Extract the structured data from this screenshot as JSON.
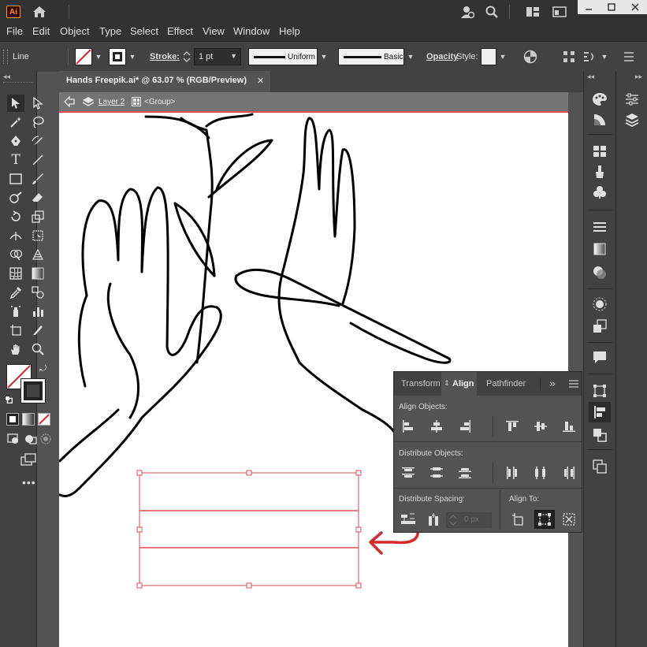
{
  "app": {
    "logo_text": "Ai"
  },
  "menu": [
    "File",
    "Edit",
    "Object",
    "Type",
    "Select",
    "Effect",
    "View",
    "Window",
    "Help"
  ],
  "control_bar": {
    "selection_type": "Line",
    "stroke_label": "Stroke:",
    "stroke_weight": "1 pt",
    "profile_label": "Uniform",
    "brush_label": "Basic",
    "opacity_label": "Opacity",
    "style_label": "Style:"
  },
  "document": {
    "tab_title": "Hands Freepik.ai* @ 63.07 % (RGB/Preview)",
    "close_glyph": "✕",
    "layer_label": "Layer 2",
    "group_label": "<Group>"
  },
  "align_panel": {
    "tabs": [
      "Transform",
      "Align",
      "Pathfinder"
    ],
    "active_tab": "Align",
    "more_glyph": "»",
    "align_objects_label": "Align Objects:",
    "distribute_objects_label": "Distribute Objects:",
    "distribute_spacing_label": "Distribute Spacing:",
    "align_to_label": "Align To:",
    "spacing_value": "0 px"
  },
  "colors": {
    "accent_red": "#e14b57",
    "annotation_red": "#d42a2a",
    "panel_bg": "#535353",
    "bar_bg": "#424242"
  }
}
